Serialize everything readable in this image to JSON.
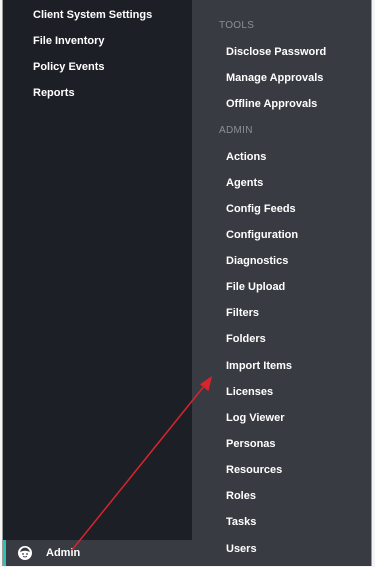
{
  "left_nav": {
    "items": [
      {
        "label": "Client System Settings"
      },
      {
        "label": "File Inventory"
      },
      {
        "label": "Policy Events"
      },
      {
        "label": "Reports"
      }
    ],
    "admin_label": "Admin"
  },
  "submenu": {
    "tools_heading": "TOOLS",
    "tools": [
      {
        "label": "Disclose Password"
      },
      {
        "label": "Manage Approvals"
      },
      {
        "label": "Offline Approvals"
      }
    ],
    "admin_heading": "ADMIN",
    "admin": [
      {
        "label": "Actions"
      },
      {
        "label": "Agents"
      },
      {
        "label": "Config Feeds"
      },
      {
        "label": "Configuration"
      },
      {
        "label": "Diagnostics"
      },
      {
        "label": "File Upload"
      },
      {
        "label": "Filters"
      },
      {
        "label": "Folders"
      },
      {
        "label": "Import Items"
      },
      {
        "label": "Licenses"
      },
      {
        "label": "Log Viewer"
      },
      {
        "label": "Personas"
      },
      {
        "label": "Resources"
      },
      {
        "label": "Roles"
      },
      {
        "label": "Tasks"
      },
      {
        "label": "Users"
      }
    ]
  },
  "colors": {
    "left_panel_bg": "#1c1f26",
    "submenu_bg": "#383b42",
    "accent": "#2bc4b4",
    "annotation_arrow": "#d8242c"
  },
  "icons": {
    "admin": "admin-face-icon"
  }
}
